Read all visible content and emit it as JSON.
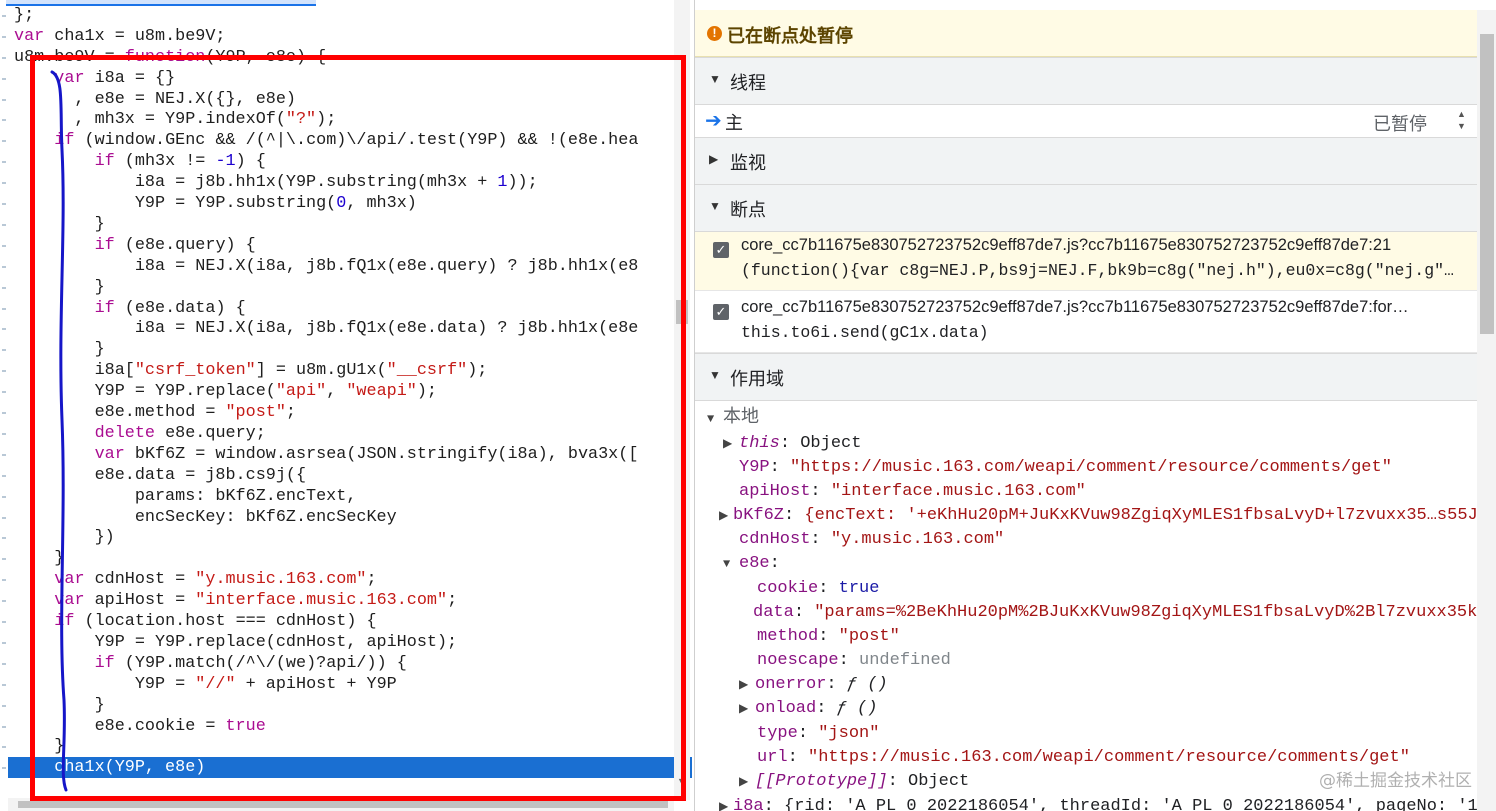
{
  "code": {
    "lines": [
      [
        [
          "",
          ""
        ]
      ],
      [
        [
          "",
          "};"
        ]
      ],
      [
        [
          "kw",
          "var"
        ],
        [
          "",
          " cha1x = u8m.be9V;"
        ]
      ],
      [
        [
          "",
          "u8m.be9V = "
        ],
        [
          "kw",
          "function"
        ],
        [
          "",
          "(Y9P, e8e) {"
        ]
      ],
      [
        [
          "",
          "    "
        ],
        [
          "kw",
          "var"
        ],
        [
          "",
          " i8a = {}"
        ]
      ],
      [
        [
          "",
          "      , e8e = NEJ.X({}, e8e)"
        ]
      ],
      [
        [
          "",
          "      , mh3x = Y9P.indexOf("
        ],
        [
          "str",
          "\"?\""
        ],
        [
          "",
          ");"
        ]
      ],
      [
        [
          "",
          "    "
        ],
        [
          "kw",
          "if"
        ],
        [
          "",
          " (window.GEnc && /(^|\\.com)\\/api/.test(Y9P) && !(e8e.hea"
        ]
      ],
      [
        [
          "",
          "        "
        ],
        [
          "kw",
          "if"
        ],
        [
          "",
          " (mh3x != "
        ],
        [
          "num",
          "-1"
        ],
        [
          "",
          ") {"
        ]
      ],
      [
        [
          "",
          "            i8a = j8b.hh1x(Y9P.substring(mh3x + "
        ],
        [
          "num",
          "1"
        ],
        [
          "",
          "));"
        ]
      ],
      [
        [
          "",
          "            Y9P = Y9P.substring("
        ],
        [
          "num",
          "0"
        ],
        [
          "",
          ", mh3x)"
        ]
      ],
      [
        [
          "",
          "        }"
        ]
      ],
      [
        [
          "",
          "        "
        ],
        [
          "kw",
          "if"
        ],
        [
          "",
          " (e8e.query) {"
        ]
      ],
      [
        [
          "",
          "            i8a = NEJ.X(i8a, j8b.fQ1x(e8e.query) ? j8b.hh1x(e8"
        ]
      ],
      [
        [
          "",
          "        }"
        ]
      ],
      [
        [
          "",
          "        "
        ],
        [
          "kw",
          "if"
        ],
        [
          "",
          " (e8e.data) {"
        ]
      ],
      [
        [
          "",
          "            i8a = NEJ.X(i8a, j8b.fQ1x(e8e.data) ? j8b.hh1x(e8e"
        ]
      ],
      [
        [
          "",
          "        }"
        ]
      ],
      [
        [
          "",
          "        i8a["
        ],
        [
          "str",
          "\"csrf_token\""
        ],
        [
          "",
          "] = u8m.gU1x("
        ],
        [
          "str",
          "\"__csrf\""
        ],
        [
          "",
          ");"
        ]
      ],
      [
        [
          "",
          "        Y9P = Y9P.replace("
        ],
        [
          "str",
          "\"api\""
        ],
        [
          "",
          ", "
        ],
        [
          "str",
          "\"weapi\""
        ],
        [
          "",
          ");"
        ]
      ],
      [
        [
          "",
          "        e8e.method = "
        ],
        [
          "str",
          "\"post\""
        ],
        [
          "",
          ";"
        ]
      ],
      [
        [
          "",
          "        "
        ],
        [
          "kw",
          "delete"
        ],
        [
          "",
          " e8e.query;"
        ]
      ],
      [
        [
          "",
          "        "
        ],
        [
          "kw",
          "var"
        ],
        [
          "",
          " bKf6Z = window.asrsea(JSON.stringify(i8a), bva3x(["
        ]
      ],
      [
        [
          "",
          "        e8e.data = j8b.cs9j({"
        ]
      ],
      [
        [
          "",
          "            params: bKf6Z.encText,"
        ]
      ],
      [
        [
          "",
          "            encSecKey: bKf6Z.encSecKey"
        ]
      ],
      [
        [
          "",
          "        })"
        ]
      ],
      [
        [
          "",
          "    }"
        ]
      ],
      [
        [
          "",
          "    "
        ],
        [
          "kw",
          "var"
        ],
        [
          "",
          " cdnHost = "
        ],
        [
          "str",
          "\"y.music.163.com\""
        ],
        [
          "",
          ";"
        ]
      ],
      [
        [
          "",
          "    "
        ],
        [
          "kw",
          "var"
        ],
        [
          "",
          " apiHost = "
        ],
        [
          "str",
          "\"interface.music.163.com\""
        ],
        [
          "",
          ";"
        ]
      ],
      [
        [
          "",
          "    "
        ],
        [
          "kw",
          "if"
        ],
        [
          "",
          " (location.host === cdnHost) {"
        ]
      ],
      [
        [
          "",
          "        Y9P = Y9P.replace(cdnHost, apiHost);"
        ]
      ],
      [
        [
          "",
          "        "
        ],
        [
          "kw",
          "if"
        ],
        [
          "",
          " (Y9P.match(/^\\/(we)?api/)) {"
        ]
      ],
      [
        [
          "",
          "            Y9P = "
        ],
        [
          "str",
          "\"//\""
        ],
        [
          "",
          " + apiHost + Y9P"
        ]
      ],
      [
        [
          "",
          "        }"
        ]
      ],
      [
        [
          "",
          "        e8e.cookie = "
        ],
        [
          "kw",
          "true"
        ]
      ],
      [
        [
          "",
          "    }"
        ]
      ],
      [
        [
          "",
          "    cha1x(Y9P, e8e)"
        ]
      ]
    ],
    "highlighted_line_index": 37
  },
  "debugger": {
    "paused_text": "已在断点处暂停",
    "sections": {
      "threads": "线程",
      "watch": "监视",
      "breakpoints": "断点",
      "scope": "作用域"
    },
    "thread": {
      "name": "主",
      "status": "已暂停"
    },
    "breakpoints": [
      {
        "file": "core_cc7b11675e830752723752c9eff87de7.js?cc7b11675e830752723752c9eff87de7:21",
        "code": "(function(){var c8g=NEJ.P,bs9j=NEJ.F,bk9b=c8g(\"nej.h\"),eu0x=c8g(\"nej.g\"…",
        "checked": true,
        "active": true
      },
      {
        "file": "core_cc7b11675e830752723752c9eff87de7.js?cc7b11675e830752723752c9eff87de7:for…",
        "code": "this.to6i.send(gC1x.data)",
        "checked": true,
        "active": false
      }
    ],
    "scope": {
      "local_label": "本地",
      "this": {
        "key": "this",
        "value": "Object"
      },
      "Y9P": {
        "key": "Y9P",
        "value": "\"https://music.163.com/weapi/comment/resource/comments/get\""
      },
      "apiHost": {
        "key": "apiHost",
        "value": "\"interface.music.163.com\""
      },
      "bKf6Z": {
        "key": "bKf6Z",
        "value": "{encText: '+eKhHu20pM+JuKxKVuw98ZgiqXyMLES1fbsaLvyD+l7zvuxx35…s55J…"
      },
      "cdnHost": {
        "key": "cdnHost",
        "value": "\"y.music.163.com\""
      },
      "e8e": {
        "key": "e8e"
      },
      "cookie": {
        "key": "cookie",
        "value": "true"
      },
      "data": {
        "key": "data",
        "value": "\"params=%2BeKhHu20pM%2BJuKxKVuw98ZgiqXyMLES1fbsaLvyD%2Bl7zvuxx35k…"
      },
      "method": {
        "key": "method",
        "value": "\"post\""
      },
      "noescape": {
        "key": "noescape",
        "value": "undefined"
      },
      "onerror": {
        "key": "onerror",
        "value": "ƒ ()"
      },
      "onload": {
        "key": "onload",
        "value": "ƒ ()"
      },
      "type": {
        "key": "type",
        "value": "\"json\""
      },
      "url": {
        "key": "url",
        "value": "\"https://music.163.com/weapi/comment/resource/comments/get\""
      },
      "prototype": {
        "key": "[[Prototype]]",
        "value": "Object"
      },
      "i8a": {
        "key": "i8a",
        "value": "{rid: 'A_PL_0_2022186054', threadId: 'A_PL_0_2022186054', pageNo: '1"
      }
    },
    "watermark": "@稀土掘金技术社区"
  },
  "colors": {
    "red_box": "#ff0000",
    "annotation_line": "#1616c8",
    "highlight": "#1a6fd2"
  }
}
